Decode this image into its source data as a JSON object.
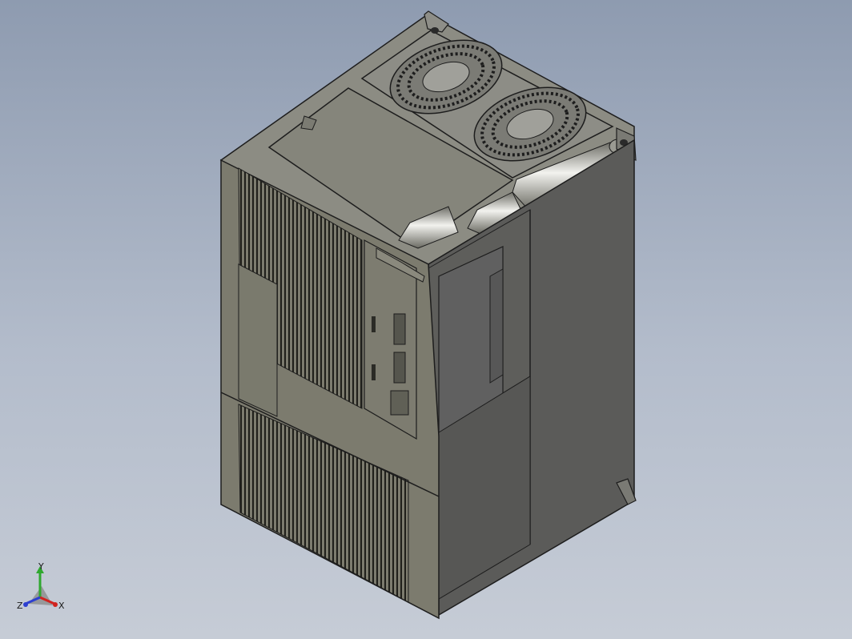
{
  "viewport": {
    "background_top": "#8e9bb0",
    "background_bottom": "#c6ccd6",
    "part_color_front": "#7c7b6e",
    "part_color_side": "#5c5c5c",
    "part_color_top": "#8a8a80"
  },
  "triad": {
    "x_label": "X",
    "y_label": "Y",
    "z_label": "Z",
    "x_color": "#d0231f",
    "y_color": "#2fa82f",
    "z_color": "#2d3fd0"
  }
}
